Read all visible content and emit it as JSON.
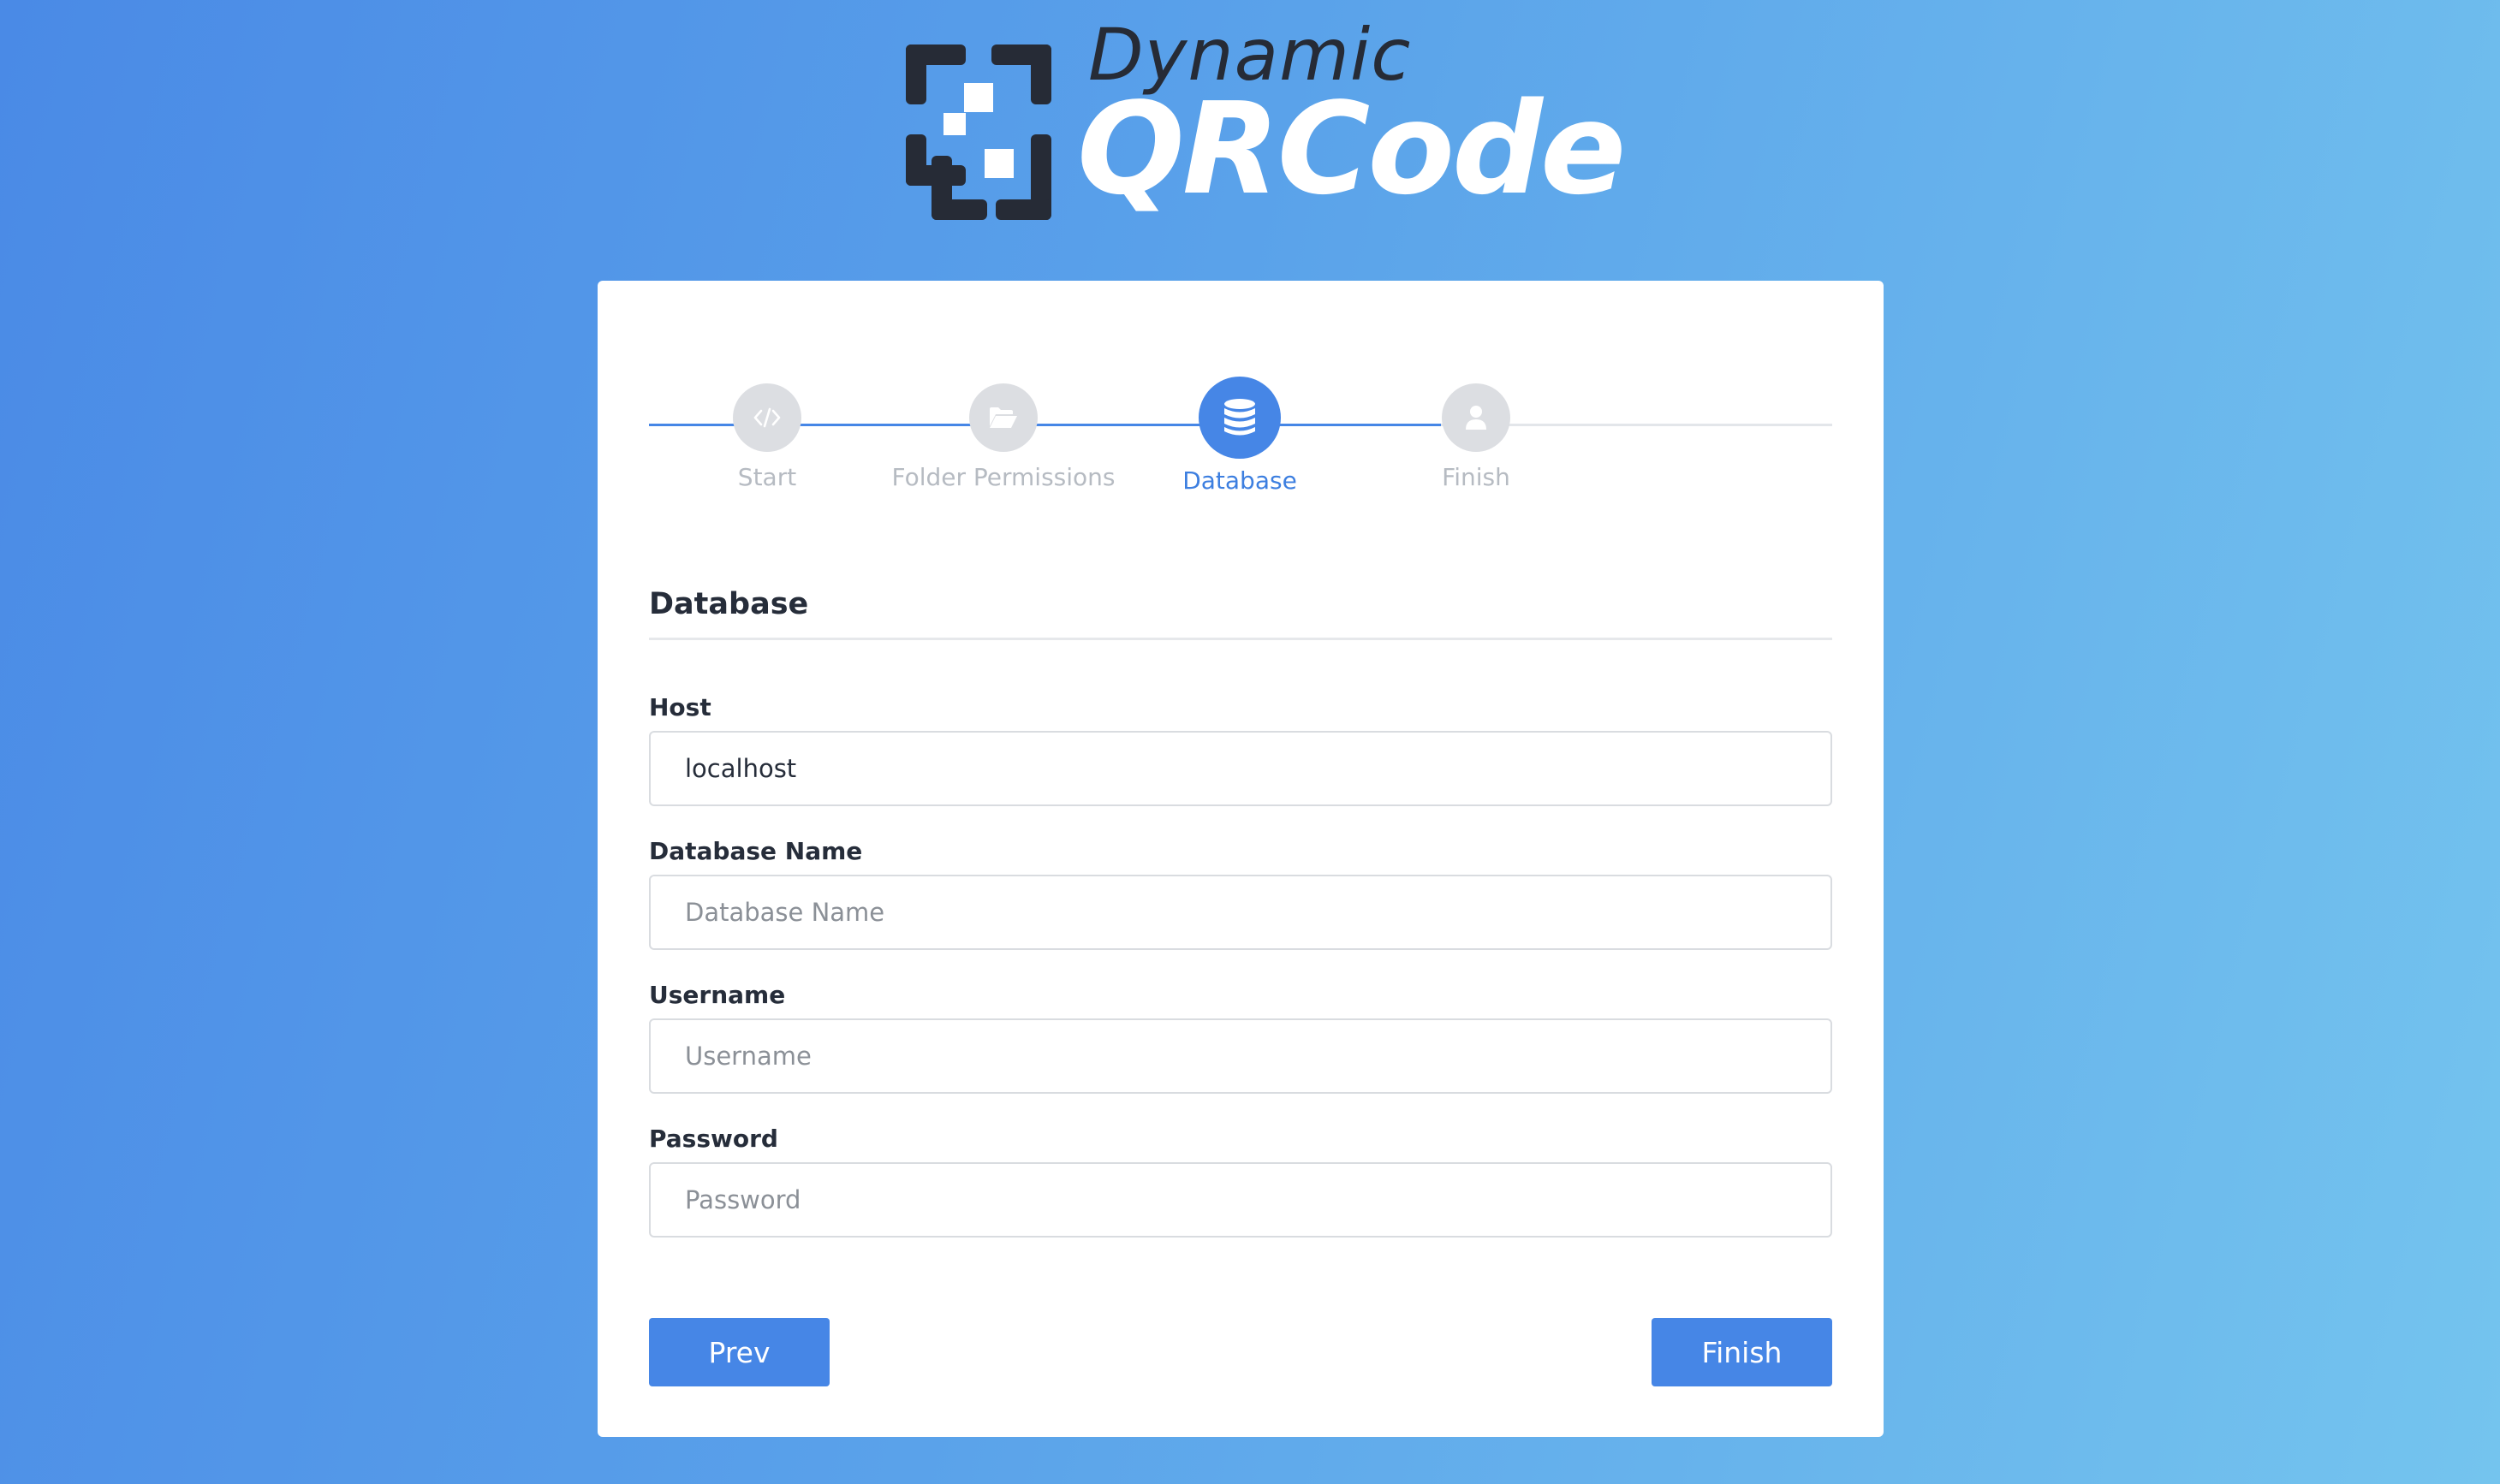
{
  "brand": {
    "line1": "Dynamic",
    "line2": "QRCode",
    "mark_color": "#262b36"
  },
  "stepper": {
    "accent": "#4686e6",
    "steps": [
      {
        "label": "Start",
        "icon": "code-icon",
        "state": "done"
      },
      {
        "label": "Folder Permissions",
        "icon": "folder-open-icon",
        "state": "done"
      },
      {
        "label": "Database",
        "icon": "database-icon",
        "state": "active"
      },
      {
        "label": "Finish",
        "icon": "user-icon",
        "state": "pending"
      }
    ]
  },
  "section": {
    "title": "Database"
  },
  "form": {
    "host": {
      "label": "Host",
      "value": "localhost",
      "placeholder": ""
    },
    "db_name": {
      "label": "Database Name",
      "value": "",
      "placeholder": "Database Name"
    },
    "username": {
      "label": "Username",
      "value": "",
      "placeholder": "Username"
    },
    "password": {
      "label": "Password",
      "value": "",
      "placeholder": "Password"
    }
  },
  "buttons": {
    "prev": "Prev",
    "finish": "Finish"
  }
}
